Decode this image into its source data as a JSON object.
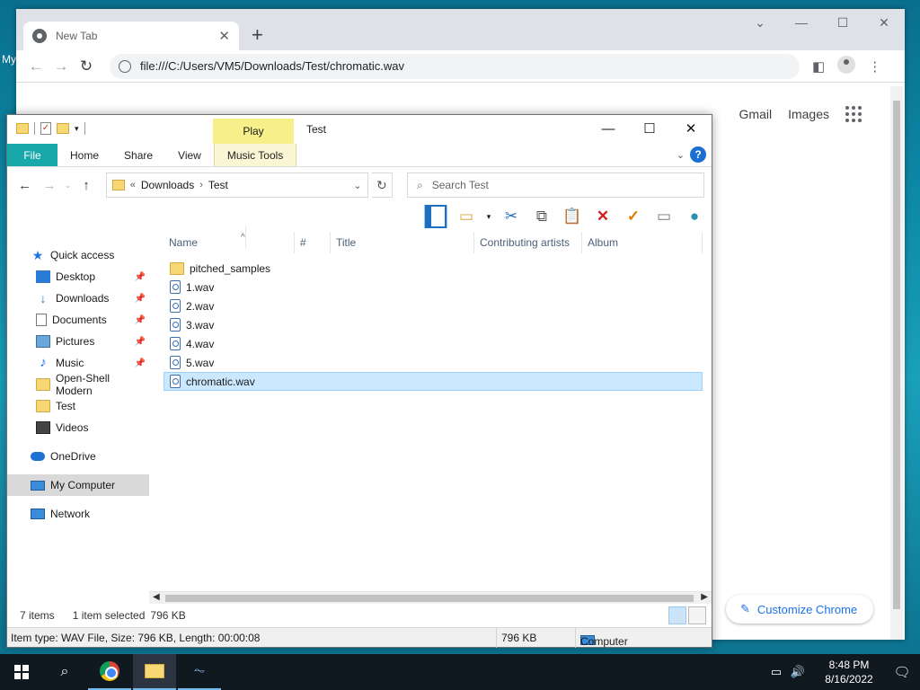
{
  "desktop": {
    "label": "My"
  },
  "chrome": {
    "tab_title": "New Tab",
    "url": "file:///C:/Users/VM5/Downloads/Test/chromatic.wav",
    "links": {
      "gmail": "Gmail",
      "images": "Images"
    },
    "customize_label": "Customize Chrome"
  },
  "explorer": {
    "title": "Test",
    "contextual_tab": "Play",
    "ribbon_tabs": {
      "file": "File",
      "home": "Home",
      "share": "Share",
      "view": "View",
      "music_tools": "Music Tools"
    },
    "address": {
      "overflow": "«",
      "crumb1": "Downloads",
      "crumb2": "Test"
    },
    "search_placeholder": "Search Test",
    "columns": {
      "name": "Name",
      "number": "#",
      "title": "Title",
      "artists": "Contributing artists",
      "album": "Album"
    },
    "nav": {
      "quick_access": "Quick access",
      "desktop": "Desktop",
      "downloads": "Downloads",
      "documents": "Documents",
      "pictures": "Pictures",
      "music": "Music",
      "openshell": "Open-Shell Modern",
      "test": "Test",
      "videos": "Videos",
      "onedrive": "OneDrive",
      "my_computer": "My Computer",
      "network": "Network"
    },
    "files": [
      {
        "name": "pitched_samples",
        "type": "folder"
      },
      {
        "name": "1.wav",
        "type": "wav"
      },
      {
        "name": "2.wav",
        "type": "wav"
      },
      {
        "name": "3.wav",
        "type": "wav"
      },
      {
        "name": "4.wav",
        "type": "wav"
      },
      {
        "name": "5.wav",
        "type": "wav"
      },
      {
        "name": "chromatic.wav",
        "type": "wav",
        "selected": true
      }
    ],
    "status": {
      "item_count": "7 items",
      "selection": "1 item selected",
      "selection_size": "796 KB",
      "details": "Item type: WAV File, Size: 796 KB, Length: 00:00:08",
      "size": "796 KB",
      "location": "Computer"
    }
  },
  "taskbar": {
    "time": "8:48 PM",
    "date": "8/16/2022"
  },
  "colors": {
    "file_tab": "#19a8a9",
    "play_tab": "#f7f08a",
    "selection": "#cce8ff",
    "accent": "#1a73e8"
  }
}
